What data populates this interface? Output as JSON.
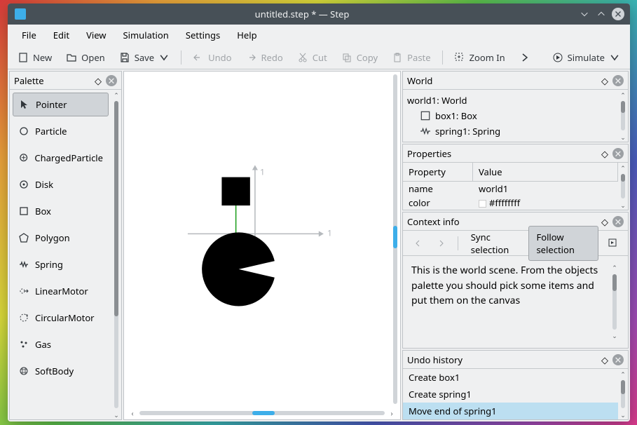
{
  "window": {
    "title": "untitled.step * — Step"
  },
  "menu": {
    "file": "File",
    "edit": "Edit",
    "view": "View",
    "simulation": "Simulation",
    "settings": "Settings",
    "help": "Help"
  },
  "toolbar": {
    "new": "New",
    "open": "Open",
    "save": "Save",
    "undo": "Undo",
    "redo": "Redo",
    "cut": "Cut",
    "copy": "Copy",
    "paste": "Paste",
    "zoom_in": "Zoom In",
    "simulate": "Simulate"
  },
  "palette": {
    "title": "Palette",
    "items": [
      "Pointer",
      "Particle",
      "ChargedParticle",
      "Disk",
      "Box",
      "Polygon",
      "Spring",
      "LinearMotor",
      "CircularMotor",
      "Gas",
      "SoftBody"
    ],
    "selected": "Pointer"
  },
  "canvas": {
    "axis_x_label": "1",
    "axis_y_label": "1"
  },
  "world": {
    "title": "World",
    "root": "world1: World",
    "children": [
      {
        "name": "box1: Box",
        "icon": "box"
      },
      {
        "name": "spring1: Spring",
        "icon": "spring"
      }
    ]
  },
  "properties": {
    "title": "Properties",
    "header_property": "Property",
    "header_value": "Value",
    "rows": [
      {
        "k": "name",
        "v": "world1"
      },
      {
        "k": "color",
        "v": "#ffffffff"
      }
    ]
  },
  "context": {
    "title": "Context info",
    "sync_label": "Sync selection",
    "follow_label": "Follow selection",
    "text": "This is the world scene. From the objects palette you should pick some items and put them on the canvas"
  },
  "undo": {
    "title": "Undo history",
    "items": [
      "Create box1",
      "Create spring1",
      "Move end of spring1"
    ],
    "selected": "Move end of spring1"
  }
}
